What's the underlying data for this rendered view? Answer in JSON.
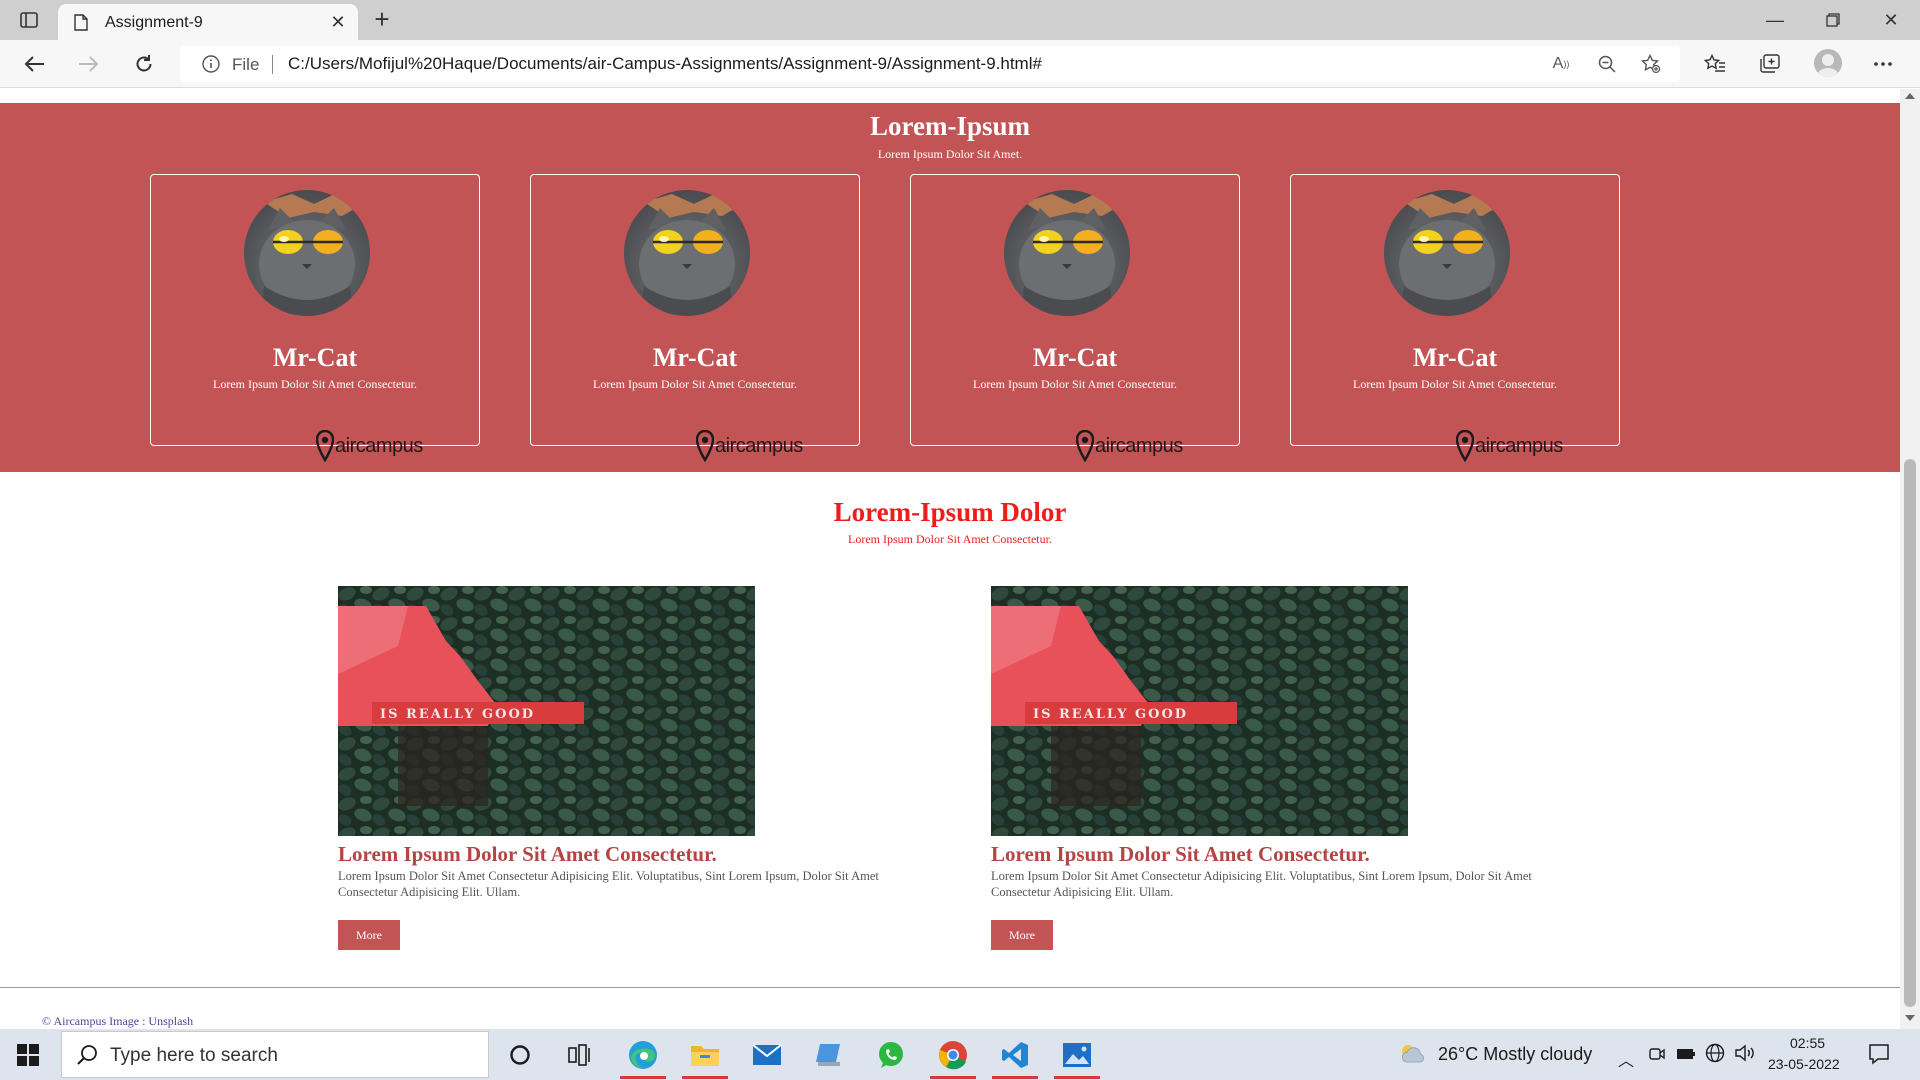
{
  "browser": {
    "tab_title": "Assignment-9",
    "address_label": "File",
    "url": "C:/Users/Mofijul%20Haque/Documents/air-Campus-Assignments/Assignment-9/Assignment-9.html#"
  },
  "team": {
    "title": "Lorem-Ipsum",
    "subtitle": "Lorem Ipsum Dolor Sit Amet.",
    "cards": [
      {
        "name": "Mr-Cat",
        "text": "Lorem Ipsum Dolor Sit Amet Consectetur.",
        "logo_text": "aircampus"
      },
      {
        "name": "Mr-Cat",
        "text": "Lorem Ipsum Dolor Sit Amet Consectetur.",
        "logo_text": "aircampus"
      },
      {
        "name": "Mr-Cat",
        "text": "Lorem Ipsum Dolor Sit Amet Consectetur.",
        "logo_text": "aircampus"
      },
      {
        "name": "Mr-Cat",
        "text": "Lorem Ipsum Dolor Sit Amet Consectetur.",
        "logo_text": "aircampus"
      }
    ]
  },
  "blog": {
    "title": "Lorem-Ipsum Dolor",
    "subtitle": "Lorem Ipsum Dolor Sit Amet Consectetur.",
    "posts": [
      {
        "image_text": "IS REALLY GOOD",
        "heading": "Lorem Ipsum Dolor Sit Amet Consectetur.",
        "body": "Lorem Ipsum Dolor Sit Amet Consectetur Adipisicing Elit. Voluptatibus, Sint Lorem Ipsum, Dolor Sit Amet Consectetur Adipisicing Elit. Ullam.",
        "button": "More"
      },
      {
        "image_text": "IS REALLY GOOD",
        "heading": "Lorem Ipsum Dolor Sit Amet Consectetur.",
        "body": "Lorem Ipsum Dolor Sit Amet Consectetur Adipisicing Elit. Voluptatibus, Sint Lorem Ipsum, Dolor Sit Amet Consectetur Adipisicing Elit. Ullam.",
        "button": "More"
      }
    ]
  },
  "footer": {
    "credit": "© Aircampus Image : Unsplash"
  },
  "taskbar": {
    "search_placeholder": "Type here to search",
    "weather": "26°C  Mostly cloudy",
    "time": "02:55",
    "date": "23-05-2022"
  },
  "colors": {
    "brand": "#c25455",
    "heading_red": "#ef1c1c",
    "post_heading": "#b44545"
  }
}
